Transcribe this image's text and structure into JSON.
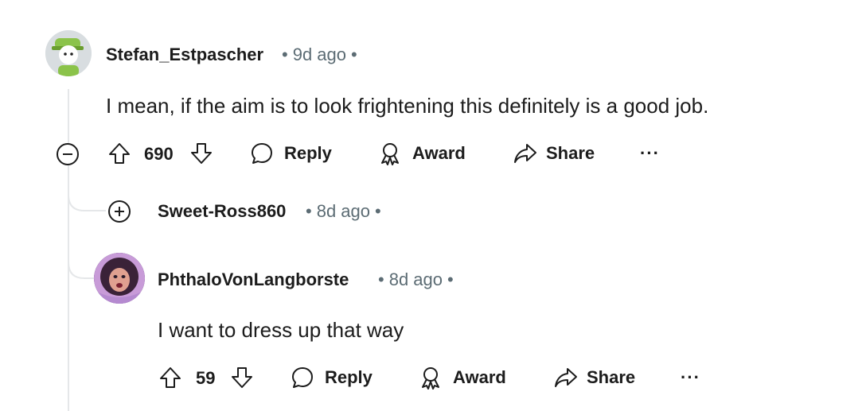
{
  "comments": [
    {
      "author": "Stefan_Estpascher",
      "time": "9d ago",
      "text": "I mean, if the aim is to look frightening this definitely is a good job.",
      "votes": "690",
      "reply_label": "Reply",
      "award_label": "Award",
      "share_label": "Share",
      "more_label": "···"
    },
    {
      "author": "Sweet-Ross860",
      "time": "8d ago"
    },
    {
      "author": "PhthaloVonLangborste",
      "time": "8d ago",
      "text": "I want to dress up that way",
      "votes": "59",
      "reply_label": "Reply",
      "award_label": "Award",
      "share_label": "Share",
      "more_label": "···"
    }
  ],
  "icons": {
    "collapse": "minus-circle-icon",
    "expand": "plus-circle-icon",
    "upvote": "arrow-up-icon",
    "downvote": "arrow-down-icon",
    "reply": "speech-bubble-icon",
    "award": "award-ribbon-icon",
    "share": "share-arrow-icon"
  },
  "colors": {
    "thread_line": "#e5e7e9",
    "meta_text": "#5c6c74",
    "avatar1_bg": "#d8dde0",
    "avatar1_hat": "#8bc34a",
    "avatar3_bg": "#5a3a7a"
  }
}
